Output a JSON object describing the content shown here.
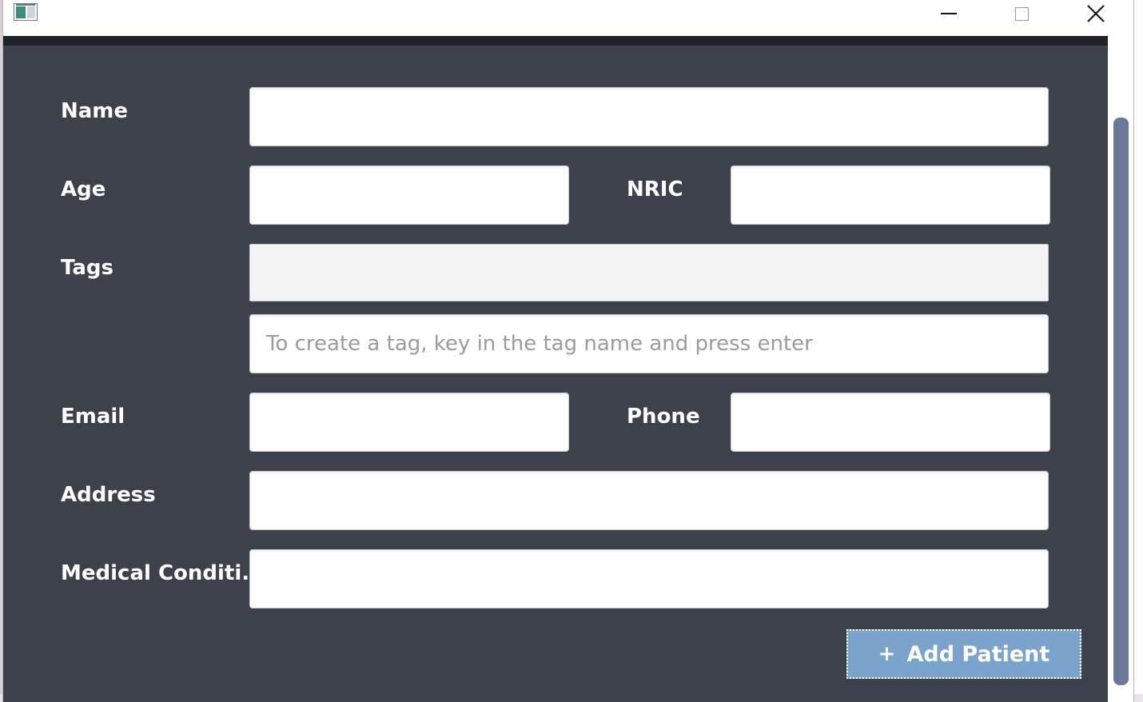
{
  "window": {
    "controls": {
      "minimize_icon": "minimize-icon",
      "maximize_icon": "maximize-icon",
      "close_icon": "close-icon"
    }
  },
  "form": {
    "name_label": "Name",
    "name_value": "",
    "age_label": "Age",
    "age_value": "",
    "nric_label": "NRIC",
    "nric_value": "",
    "tags_label": "Tags",
    "tag_input_placeholder": "To create a tag, key in the tag name and press enter",
    "email_label": "Email",
    "email_value": "",
    "phone_label": "Phone",
    "phone_value": "",
    "address_label": "Address",
    "address_value": "",
    "medical_label": "Medical Conditi...",
    "medical_value": ""
  },
  "actions": {
    "add_icon": "+",
    "add_label": "Add Patient"
  },
  "colors": {
    "panel_bg": "#3c414c",
    "accent_button": "#7ba3cc",
    "scroll_thumb": "#6b7896"
  }
}
